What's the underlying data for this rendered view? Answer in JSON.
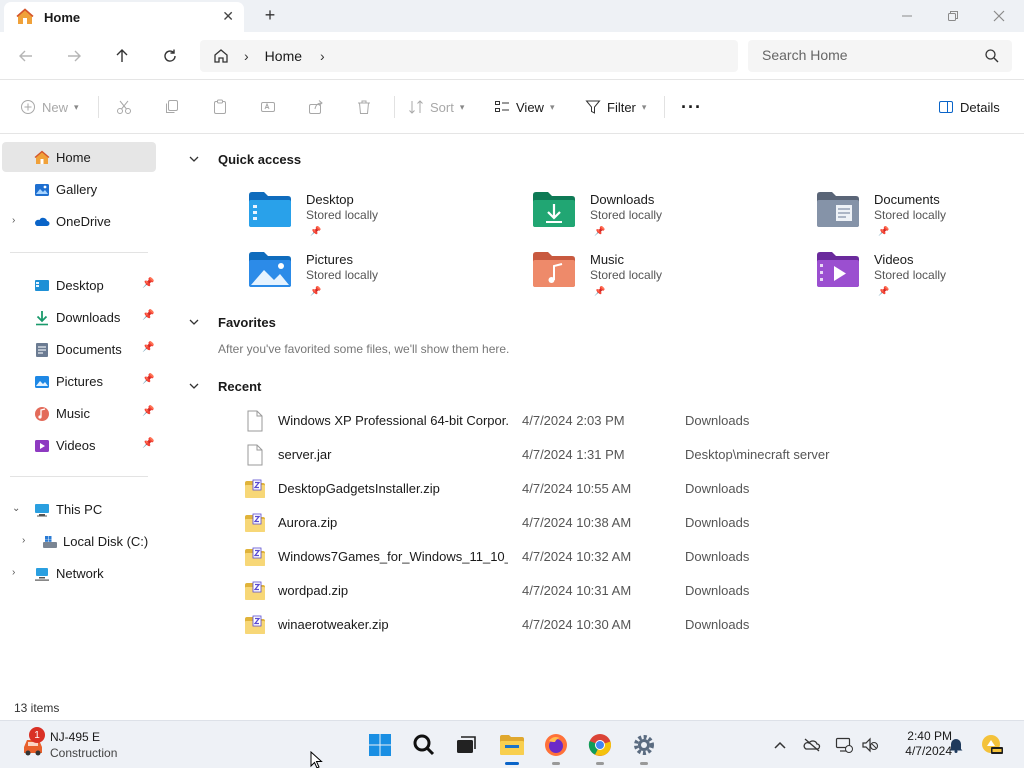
{
  "window": {
    "tab_title": "Home",
    "new_tab_label": "+",
    "close_tab_label": "✕"
  },
  "nav": {
    "breadcrumb": [
      "Home"
    ],
    "search_placeholder": "Search Home"
  },
  "commands": {
    "new_label": "New",
    "sort_label": "Sort",
    "view_label": "View",
    "filter_label": "Filter",
    "more_label": "···",
    "details_label": "Details"
  },
  "sidebar": {
    "top": [
      {
        "label": "Home",
        "icon": "home-icon",
        "selected": true
      },
      {
        "label": "Gallery",
        "icon": "gallery-icon"
      },
      {
        "label": "OneDrive",
        "icon": "onedrive-icon",
        "expandable": true
      }
    ],
    "pinned": [
      {
        "label": "Desktop",
        "icon": "desktop-icon"
      },
      {
        "label": "Downloads",
        "icon": "downloads-icon"
      },
      {
        "label": "Documents",
        "icon": "documents-icon"
      },
      {
        "label": "Pictures",
        "icon": "pictures-icon"
      },
      {
        "label": "Music",
        "icon": "music-icon"
      },
      {
        "label": "Videos",
        "icon": "videos-icon"
      }
    ],
    "devices": [
      {
        "label": "This PC",
        "icon": "this-pc-icon",
        "expanded": true
      },
      {
        "label": "Local Disk (C:)",
        "icon": "drive-icon"
      },
      {
        "label": "Network",
        "icon": "network-icon"
      }
    ]
  },
  "main": {
    "quick_access_title": "Quick access",
    "quick_access": [
      {
        "name": "Desktop",
        "sub": "Stored locally",
        "icon": "desktop-folder-icon"
      },
      {
        "name": "Downloads",
        "sub": "Stored locally",
        "icon": "downloads-folder-icon"
      },
      {
        "name": "Documents",
        "sub": "Stored locally",
        "icon": "documents-folder-icon"
      },
      {
        "name": "Pictures",
        "sub": "Stored locally",
        "icon": "pictures-folder-icon"
      },
      {
        "name": "Music",
        "sub": "Stored locally",
        "icon": "music-folder-icon"
      },
      {
        "name": "Videos",
        "sub": "Stored locally",
        "icon": "videos-folder-icon"
      }
    ],
    "favorites_title": "Favorites",
    "favorites_empty": "After you've favorited some files, we'll show them here.",
    "recent_title": "Recent",
    "recent": [
      {
        "name": "Windows XP Professional 64-bit Corpor...",
        "date": "4/7/2024 2:03 PM",
        "location": "Downloads",
        "type": "file"
      },
      {
        "name": "server.jar",
        "date": "4/7/2024 1:31 PM",
        "location": "Desktop\\minecraft server",
        "type": "file"
      },
      {
        "name": "DesktopGadgetsInstaller.zip",
        "date": "4/7/2024 10:55 AM",
        "location": "Downloads",
        "type": "zip"
      },
      {
        "name": "Aurora.zip",
        "date": "4/7/2024 10:38 AM",
        "location": "Downloads",
        "type": "zip"
      },
      {
        "name": "Windows7Games_for_Windows_11_10_...",
        "date": "4/7/2024 10:32 AM",
        "location": "Downloads",
        "type": "zip"
      },
      {
        "name": "wordpad.zip",
        "date": "4/7/2024 10:31 AM",
        "location": "Downloads",
        "type": "zip"
      },
      {
        "name": "winaerotweaker.zip",
        "date": "4/7/2024 10:30 AM",
        "location": "Downloads",
        "type": "zip"
      }
    ]
  },
  "status": {
    "item_count": "13 items"
  },
  "taskbar": {
    "weather_line1": "NJ-495 E",
    "weather_line2": "Construction",
    "weather_badge": "1",
    "time": "2:40 PM",
    "date": "4/7/2024",
    "apps": [
      "start-icon",
      "search-icon",
      "task-view-icon",
      "file-explorer-icon",
      "firefox-icon",
      "chrome-icon",
      "settings-icon"
    ]
  },
  "colors": {
    "accent": "#0a64c8",
    "folder_yellow": "#f4c542",
    "selected_bg": "#e6e6e6"
  }
}
